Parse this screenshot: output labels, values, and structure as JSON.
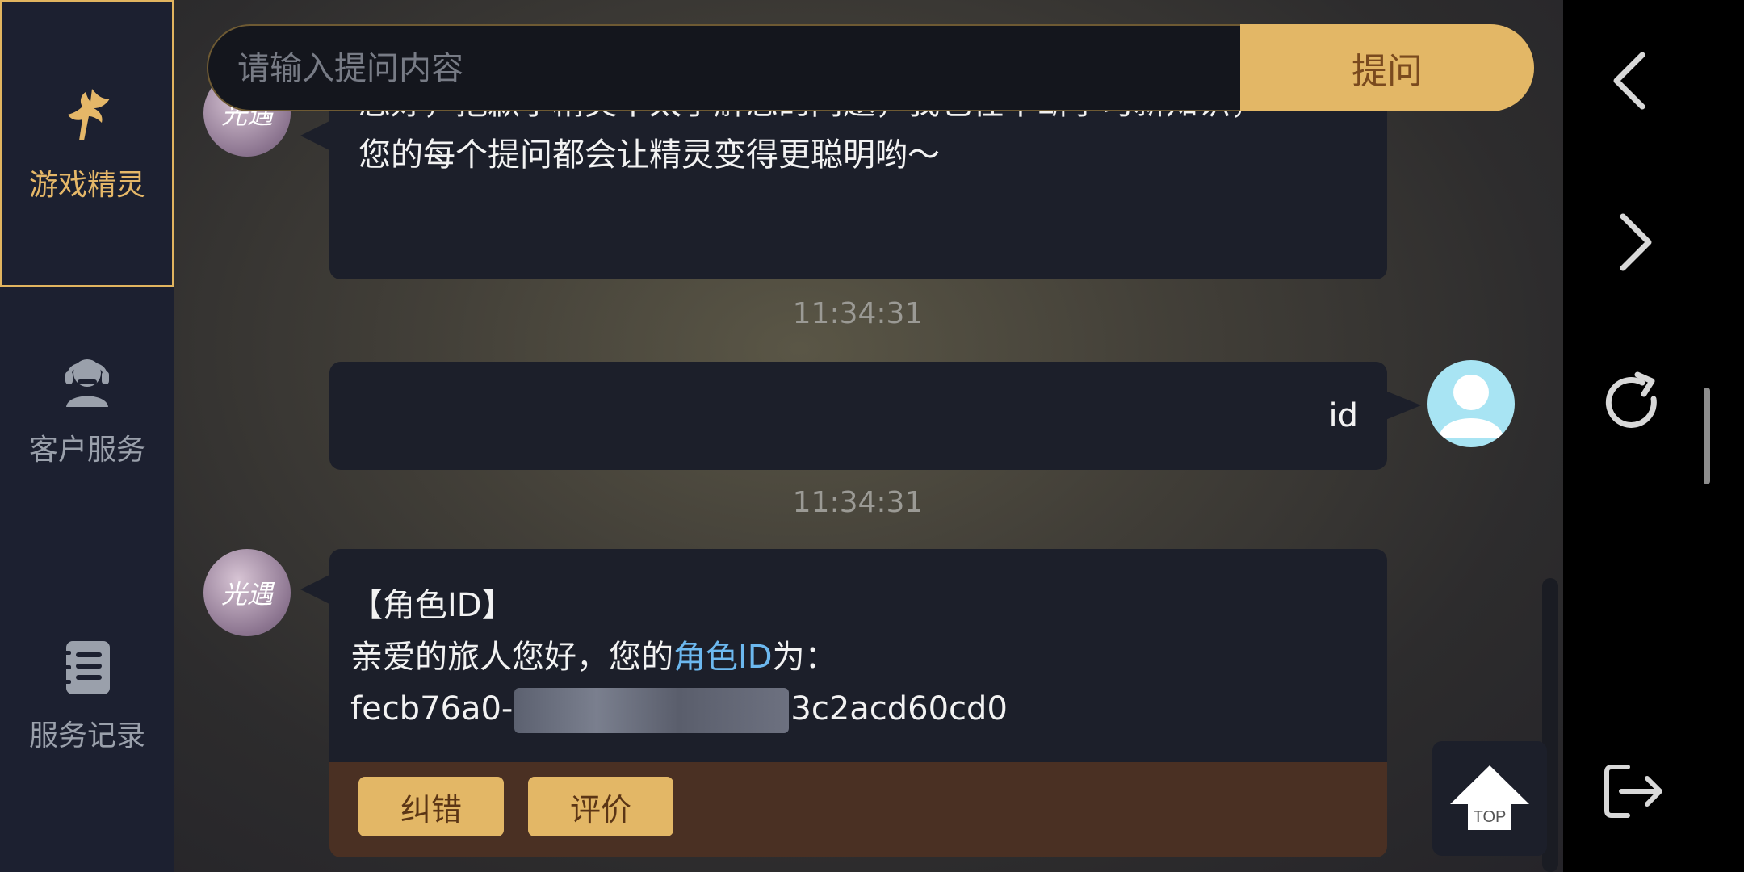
{
  "sidebar": {
    "items": [
      {
        "label": "游戏精灵",
        "icon": "fairy-icon",
        "active": true
      },
      {
        "label": "客户服务",
        "icon": "customer-service-icon",
        "active": false
      },
      {
        "label": "服务记录",
        "icon": "records-icon",
        "active": false
      }
    ]
  },
  "search": {
    "placeholder": "请输入提问内容",
    "submit_label": "提问"
  },
  "messages": [
    {
      "sender": "bot",
      "lines": [
        "您好，抱歉小精灵不太了解您的问题，我也在不断学习新知识，",
        "您的每个提问都会让精灵变得更聪明哟～"
      ]
    },
    {
      "timestamp": "11:34:31"
    },
    {
      "sender": "user",
      "text": "id"
    },
    {
      "timestamp": "11:34:31"
    },
    {
      "sender": "bot",
      "title": "【角色ID】",
      "line2_prefix": "亲爱的旅人您好，您的",
      "line2_highlight": "角色ID",
      "line2_suffix": "为：",
      "id_start": "fecb76a0-",
      "id_end": "3c2acd60cd0"
    }
  ],
  "bot_avatar_text": "光遇",
  "actions": {
    "correct_label": "纠错",
    "rate_label": "评价"
  },
  "top_button_label": "TOP",
  "colors": {
    "accent": "#e3b766",
    "highlight_link": "#6cb8ef",
    "bubble": "#1c1f2a",
    "sidebar": "#1c2030"
  },
  "right_nav": [
    "back-icon",
    "forward-icon",
    "refresh-icon",
    "exit-icon"
  ]
}
